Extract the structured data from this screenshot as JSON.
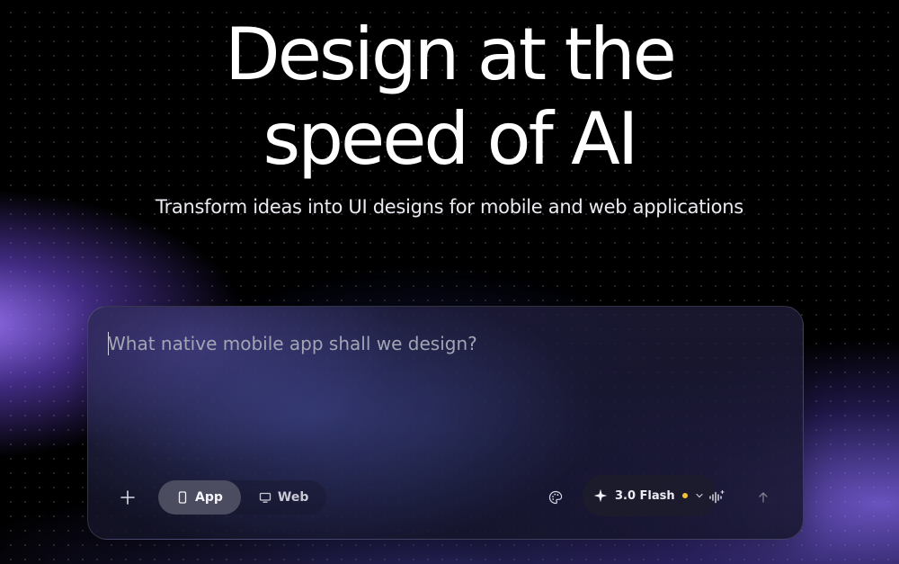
{
  "hero": {
    "headline_line1": "Design at the",
    "headline_line2": "speed of AI",
    "subtitle": "Transform ideas into UI designs for mobile and web applications"
  },
  "prompt": {
    "placeholder": "What native mobile app shall we design?",
    "value": ""
  },
  "toolbar": {
    "add_icon": "plus-icon",
    "modes": [
      {
        "label": "App",
        "icon": "phone-icon",
        "selected": true
      },
      {
        "label": "Web",
        "icon": "monitor-icon",
        "selected": false
      }
    ],
    "palette_icon": "palette-icon",
    "model": {
      "label": "3.0 Flash",
      "icon": "sparkle-icon",
      "status_color": "#f2c233"
    },
    "voice_icon": "voice-waveform-icon",
    "send_icon": "arrow-up-icon"
  },
  "colors": {
    "background": "#000000",
    "accent_purple": "#9b78ff",
    "status_yellow": "#f2c233"
  }
}
